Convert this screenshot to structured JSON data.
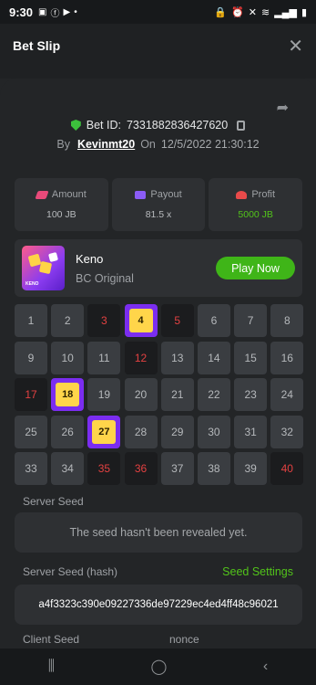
{
  "status_bar": {
    "time": "9:30",
    "dot": "•"
  },
  "header": {
    "title": "Bet Slip",
    "close": "✕"
  },
  "bet": {
    "id_label": "Bet ID:",
    "id": "7331882836427620",
    "by_label": "By",
    "user": "Kevinmt20",
    "on_label": "On",
    "date": "12/5/2022 21:30:12"
  },
  "stats": [
    {
      "label": "Amount",
      "value": "100 JB",
      "icon": "amount-icon",
      "color": "#e84a7a"
    },
    {
      "label": "Payout",
      "value": "81.5 x",
      "icon": "payout-icon",
      "color": "#8b5cf6"
    },
    {
      "label": "Profit",
      "value": "5000 JB",
      "icon": "profit-icon",
      "color": "#e84a4a"
    }
  ],
  "game": {
    "name": "Keno",
    "provider": "BC Original",
    "play_label": "Play Now",
    "thumb_text": "KENO"
  },
  "keno": {
    "hits": [
      4,
      18,
      27
    ],
    "misses": [
      3,
      5,
      12,
      17,
      35,
      36,
      40
    ],
    "numbers": [
      1,
      2,
      3,
      4,
      5,
      6,
      7,
      8,
      9,
      10,
      11,
      12,
      13,
      14,
      15,
      16,
      17,
      18,
      19,
      20,
      21,
      22,
      23,
      24,
      25,
      26,
      27,
      28,
      29,
      30,
      31,
      32,
      33,
      34,
      35,
      36,
      37,
      38,
      39,
      40
    ]
  },
  "seeds": {
    "server_seed_label": "Server Seed",
    "server_seed_value": "The seed hasn't been revealed yet.",
    "server_hash_label": "Server Seed (hash)",
    "seed_settings_label": "Seed Settings",
    "server_hash_value": "a4f3323c390e09227336de97229ec4ed4ff48c96021",
    "client_seed_label": "Client Seed",
    "nonce_label": "nonce"
  },
  "colors": {
    "accent_green": "#3fb518",
    "hit_purple": "#7b2df0",
    "hit_yellow": "#ffd54a",
    "miss_red": "#e34141"
  }
}
